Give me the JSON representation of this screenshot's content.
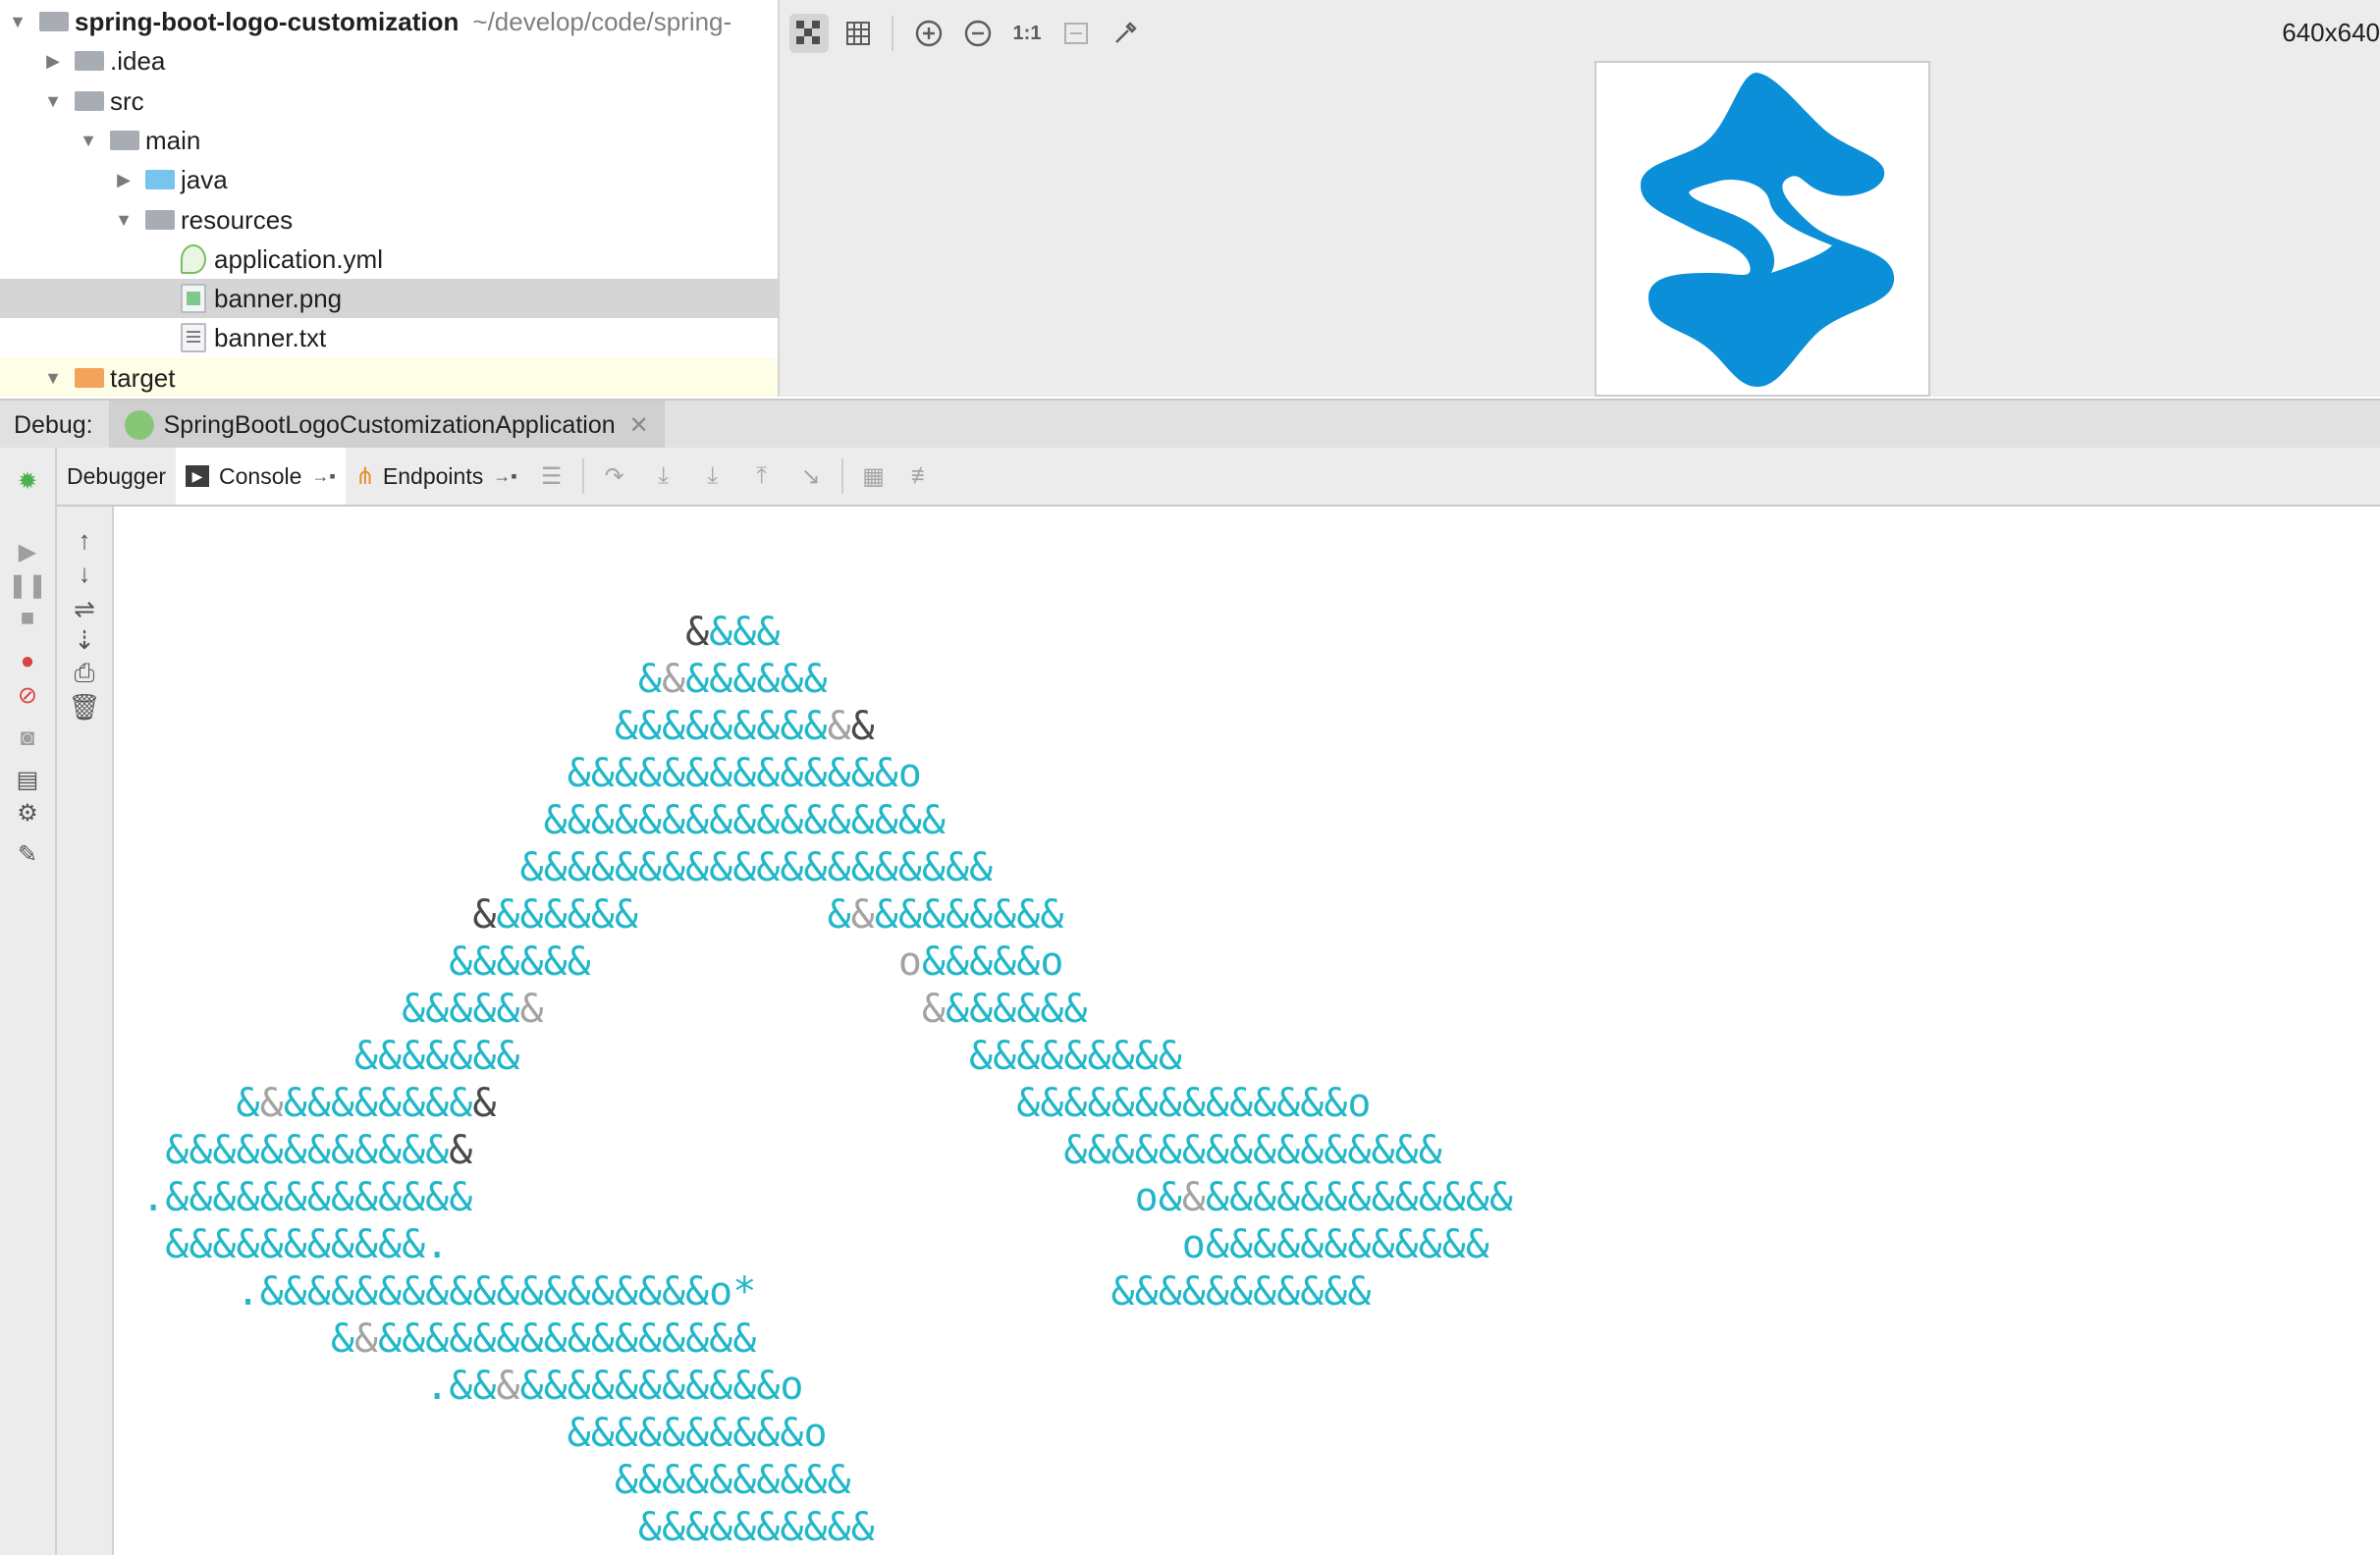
{
  "project_tree": {
    "items": [
      {
        "label": "spring-boot-logo-customization",
        "path": "~/develop/code/spring-",
        "depth": 0,
        "expanded": true,
        "icon": "project-folder-icon"
      },
      {
        "label": ".idea",
        "depth": 1,
        "expanded": false,
        "icon": "folder-icon"
      },
      {
        "label": "src",
        "depth": 1,
        "expanded": true,
        "icon": "folder-icon"
      },
      {
        "label": "main",
        "depth": 2,
        "expanded": true,
        "icon": "folder-icon"
      },
      {
        "label": "java",
        "depth": 3,
        "expanded": false,
        "icon": "source-folder-icon"
      },
      {
        "label": "resources",
        "depth": 3,
        "expanded": true,
        "icon": "resources-folder-icon"
      },
      {
        "label": "application.yml",
        "depth": 4,
        "icon": "spring-config-file-icon"
      },
      {
        "label": "banner.png",
        "depth": 4,
        "icon": "image-file-icon",
        "selected": true
      },
      {
        "label": "banner.txt",
        "depth": 4,
        "icon": "text-file-icon"
      },
      {
        "label": "target",
        "depth": 1,
        "expanded": true,
        "icon": "excluded-folder-icon"
      }
    ]
  },
  "image_viewer": {
    "size_label": "640x640",
    "toolbar": [
      "chessboard-icon",
      "grid-icon",
      "zoom-in-icon",
      "zoom-out-icon",
      "actual-size-icon",
      "fit-icon",
      "color-picker-icon"
    ],
    "actual_size_label": "1:1",
    "logo_color": "#0a8fd8"
  },
  "debug": {
    "label": "Debug:",
    "run_config": "SpringBootLogoCustomizationApplication",
    "tabs": [
      {
        "label": "Debugger",
        "active": false
      },
      {
        "label": "Console",
        "active": true
      },
      {
        "label": "Endpoints",
        "active": false
      }
    ]
  },
  "console": {
    "banner_lines": [
      [
        [
          "                         ",
          ""
        ],
        [
          "&",
          "dk"
        ],
        [
          "&&&",
          ""
        ]
      ],
      [
        [
          "                       ",
          ""
        ],
        [
          "&",
          ""
        ],
        [
          "&",
          "gr"
        ],
        [
          "&&&&&&",
          ""
        ]
      ],
      [
        [
          "                      ",
          ""
        ],
        [
          "&&&&&&&&&",
          ""
        ],
        [
          "&",
          "gr"
        ],
        [
          "&",
          "dk"
        ]
      ],
      [
        [
          "                    ",
          ""
        ],
        [
          "&&&&&&&&&&&&&&o",
          ""
        ]
      ],
      [
        [
          "                   ",
          ""
        ],
        [
          "&&&&&&&&&&&&&&&&&",
          ""
        ]
      ],
      [
        [
          "                  ",
          ""
        ],
        [
          "&&&&&&&&&&&&&&&&&&&&",
          ""
        ]
      ],
      [
        [
          "                ",
          ""
        ],
        [
          "&",
          "dk"
        ],
        [
          "&&&&&&",
          ""
        ],
        [
          "        ",
          ""
        ],
        [
          "&",
          ""
        ],
        [
          "&",
          "gr"
        ],
        [
          "&&&&&&&&",
          ""
        ]
      ],
      [
        [
          "               ",
          ""
        ],
        [
          "&&&&&&",
          ""
        ],
        [
          "             ",
          ""
        ],
        [
          "o",
          "gr"
        ],
        [
          "&&&&&",
          ""
        ],
        [
          "o",
          ""
        ]
      ],
      [
        [
          "             ",
          ""
        ],
        [
          "&&&&&",
          ""
        ],
        [
          "&",
          "gr"
        ],
        [
          "                ",
          ""
        ],
        [
          "&",
          "gr"
        ],
        [
          "&&&&&&",
          ""
        ]
      ],
      [
        [
          "           ",
          ""
        ],
        [
          "&&&&&&&",
          ""
        ],
        [
          "                   ",
          ""
        ],
        [
          "&&&&&&&&&",
          ""
        ]
      ],
      [
        [
          "      ",
          ""
        ],
        [
          "&",
          ""
        ],
        [
          "&",
          "gr"
        ],
        [
          "&&&&&&&&",
          ""
        ],
        [
          "&",
          "dk"
        ],
        [
          "                      ",
          ""
        ],
        [
          "&&&&&&&&&&&&&&o",
          ""
        ]
      ],
      [
        [
          "   ",
          ""
        ],
        [
          "&&&&&&&&&&&&",
          ""
        ],
        [
          "&",
          "dk"
        ],
        [
          "                         ",
          ""
        ],
        [
          "&&&&&&&&&&&&&&&&",
          ""
        ]
      ],
      [
        [
          "  ",
          ""
        ],
        [
          ".&&&&&&&&&&&&&",
          ""
        ],
        [
          "                            ",
          ""
        ],
        [
          "o&",
          ""
        ],
        [
          "&",
          "gr"
        ],
        [
          "&&&&&&&&&&&&&",
          ""
        ]
      ],
      [
        [
          "   ",
          ""
        ],
        [
          "&&&&&&&&&&&.",
          ""
        ],
        [
          "                               ",
          ""
        ],
        [
          "o&&&&&&&&&&&&",
          ""
        ]
      ],
      [
        [
          "      ",
          ""
        ],
        [
          ".&&&&&&&&&&&&&&&&&&&o*",
          ""
        ],
        [
          "               ",
          ""
        ],
        [
          "&&&&&&&&&&&",
          ""
        ]
      ],
      [
        [
          "          ",
          ""
        ],
        [
          "&",
          ""
        ],
        [
          "&",
          "gr"
        ],
        [
          "&&&&&&&&&&&&&&&&",
          ""
        ]
      ],
      [
        [
          "              ",
          ""
        ],
        [
          ".&&",
          ""
        ],
        [
          "&",
          "gr"
        ],
        [
          "&&&&&&&&&&&o",
          ""
        ]
      ],
      [
        [
          "                    ",
          ""
        ],
        [
          "&&&&&&&&&&o",
          ""
        ]
      ],
      [
        [
          "                      ",
          ""
        ],
        [
          "&&&&&&&&&&",
          ""
        ]
      ],
      [
        [
          "                       ",
          ""
        ],
        [
          "&&&&&&&&&&",
          ""
        ]
      ]
    ]
  }
}
